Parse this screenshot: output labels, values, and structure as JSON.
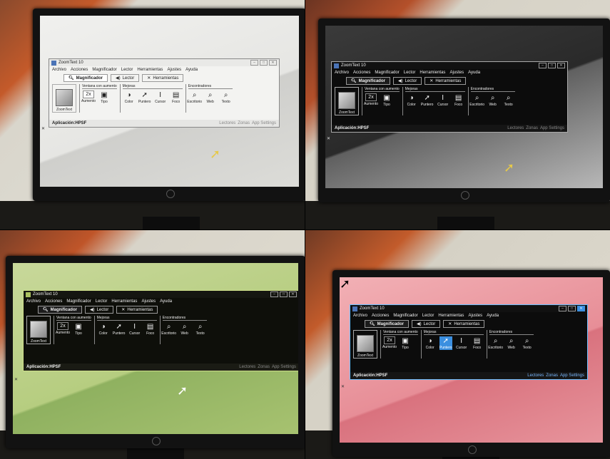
{
  "photos": [
    {
      "theme": "normal",
      "colors": {
        "window_bg": "#f3f3f1",
        "text": "#222222",
        "screen": "#e6e6e3"
      }
    },
    {
      "theme": "inverted-dark",
      "colors": {
        "window_bg": "#0c0c0c",
        "text": "#eeeeee",
        "screen": "#2a2a2a"
      }
    },
    {
      "theme": "yellow-green-tint",
      "colors": {
        "window_bg": "#0e0f0a",
        "text": "#eeeeee",
        "screen": "#b6cd80"
      }
    },
    {
      "theme": "inverted-pink",
      "colors": {
        "window_bg": "#0c0c0c",
        "text": "#eeeeee",
        "screen": "#e78e97",
        "selection": "#3b8fe0"
      }
    }
  ],
  "zoomtext": {
    "title": "ZoomText 10",
    "menu": [
      "Archivo",
      "Acciones",
      "Magnificador",
      "Lector",
      "Herramientas",
      "Ajustes",
      "Ayuda"
    ],
    "tabs": [
      {
        "label": "Magnificador",
        "icon": "magnifier-icon"
      },
      {
        "label": "Lector",
        "icon": "speaker-icon"
      },
      {
        "label": "Herramientas",
        "icon": "tools-icon"
      }
    ],
    "big_button": "ZoomText",
    "groups": {
      "ventana": {
        "title": "Ventana con aumento",
        "zoom_value": "2x",
        "aumento": "Aumento",
        "tipo": "Tipo"
      },
      "mejoras": {
        "title": "Mejoras",
        "items": [
          "Color",
          "Puntero",
          "Cursor",
          "Foco"
        ]
      },
      "encontradores": {
        "title": "Encontradores",
        "items": [
          "Escritorio",
          "Web",
          "Texto"
        ]
      }
    },
    "status": {
      "app_label": "Aplicación:",
      "app_value": "HPSF",
      "right": [
        "Lectores",
        "Zonas",
        "App Settings"
      ]
    }
  },
  "selected_tool_in_photo_4": "Puntero"
}
